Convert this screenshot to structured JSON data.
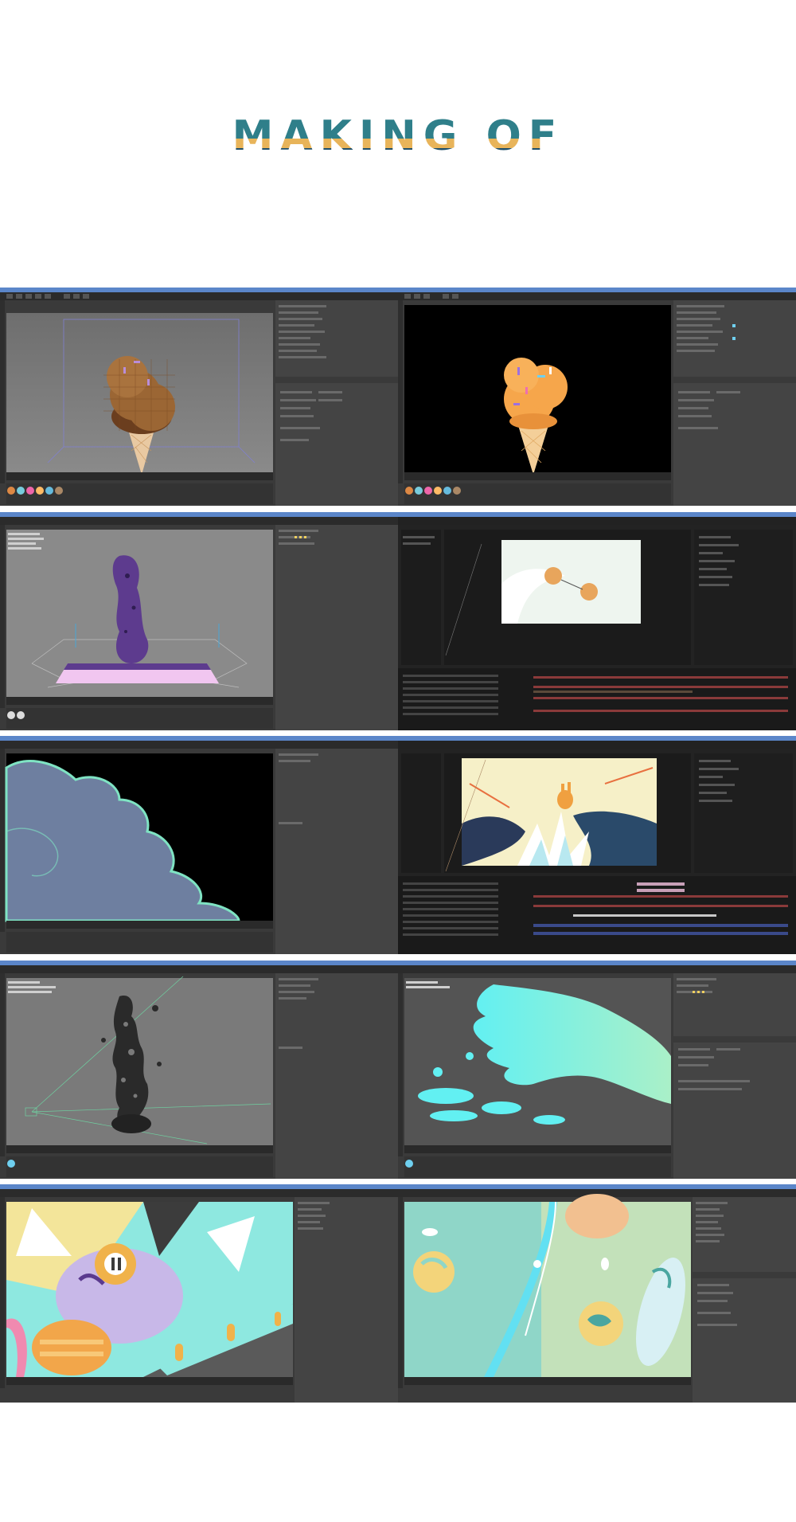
{
  "page": {
    "title": "MAKING OF"
  },
  "palette": {
    "title_teal": "#2f7f8a",
    "title_gold": "#e8b45a",
    "app_bg": "#3a3a3a",
    "panel": "#474747",
    "panel_dark": "#2a2a2a",
    "accent_blue": "#3c79c8",
    "cone_orange": "#f4a64a",
    "choco": "#8b5a2b",
    "cyan": "#62f0f2",
    "cloud_blue": "#6e7fa0",
    "cloud_line": "#7fe3c3",
    "pink": "#f1c6f0",
    "purple": "#5d3b8e"
  },
  "screenshots": [
    {
      "app": "cinema4d",
      "scene": "chocolate-ice-cream-wireframe"
    },
    {
      "app": "cinema4d",
      "scene": "orange-ice-cream-render"
    },
    {
      "app": "cinema4d",
      "scene": "purple-splash-simulation"
    },
    {
      "app": "after-effects",
      "scene": "two-spheres-animation"
    },
    {
      "app": "cinema4d",
      "scene": "blue-cloud-outline"
    },
    {
      "app": "after-effects",
      "scene": "bunny-explosion"
    },
    {
      "app": "cinema4d",
      "scene": "dark-splash-mesh"
    },
    {
      "app": "cinema4d",
      "scene": "cyan-splash-render"
    },
    {
      "app": "cinema4d",
      "scene": "robot-character-closeup"
    },
    {
      "app": "cinema4d",
      "scene": "cosmic-pipe-scene"
    }
  ]
}
